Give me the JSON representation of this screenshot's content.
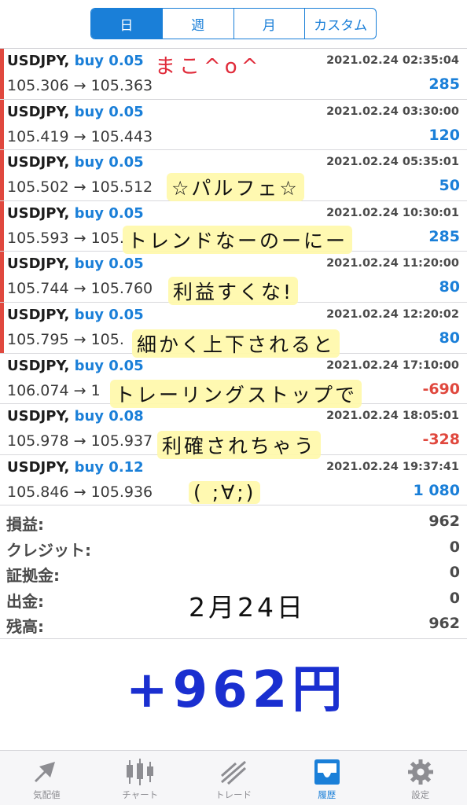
{
  "period_tabs": [
    {
      "label": "日",
      "active": true
    },
    {
      "label": "週",
      "active": false
    },
    {
      "label": "月",
      "active": false
    },
    {
      "label": "カスタム",
      "active": false
    }
  ],
  "deals": [
    {
      "symbol": "USDJPY,",
      "side": "buy 0.05",
      "prices": "105.306 → 105.363",
      "time": "2021.02.24 02:35:04",
      "profit": "285",
      "negative": false
    },
    {
      "symbol": "USDJPY,",
      "side": "buy 0.05",
      "prices": "105.419 → 105.443",
      "time": "2021.02.24 03:30:00",
      "profit": "120",
      "negative": false
    },
    {
      "symbol": "USDJPY,",
      "side": "buy 0.05",
      "prices": "105.502 → 105.512",
      "time": "2021.02.24 05:35:01",
      "profit": "50",
      "negative": false
    },
    {
      "symbol": "USDJPY,",
      "side": "buy 0.05",
      "prices": "105.593 → 105.",
      "time": "2021.02.24 10:30:01",
      "profit": "285",
      "negative": false
    },
    {
      "symbol": "USDJPY,",
      "side": "buy 0.05",
      "prices": "105.744 → 105.760",
      "time": "2021.02.24 11:20:00",
      "profit": "80",
      "negative": false
    },
    {
      "symbol": "USDJPY,",
      "side": "buy 0.05",
      "prices": "105.795 → 105.",
      "time": "2021.02.24 12:20:02",
      "profit": "80",
      "negative": false
    },
    {
      "symbol": "USDJPY,",
      "side": "buy 0.05",
      "prices": "106.074 → 1",
      "time": "2021.02.24 17:10:00",
      "profit": "-690",
      "negative": true
    },
    {
      "symbol": "USDJPY,",
      "side": "buy 0.08",
      "prices": "105.978 → 105.937",
      "time": "2021.02.24 18:05:01",
      "profit": "-328",
      "negative": true
    },
    {
      "symbol": "USDJPY,",
      "side": "buy 0.12",
      "prices": "105.846 → 105.936",
      "time": "2021.02.24 19:37:41",
      "profit": "1 080",
      "negative": false
    }
  ],
  "summary": [
    {
      "label": "損益:",
      "value": "962"
    },
    {
      "label": "クレジット:",
      "value": "0"
    },
    {
      "label": "証拠金:",
      "value": "0"
    },
    {
      "label": "出金:",
      "value": "0"
    },
    {
      "label": "残高:",
      "value": "962"
    }
  ],
  "overlay": {
    "signature": "まこ^o^",
    "line1": "☆パルフェ☆",
    "line2": "トレンドなーのーにー",
    "line3": "利益すくな!",
    "line4": "細かく上下されると",
    "line5": "トレーリングストップで",
    "line6": "利確されちゃう",
    "line7": "( ;∀;)",
    "date": "2月24日",
    "total": "+962円"
  },
  "tabbar": [
    {
      "label": "気配値",
      "icon": "quotes-icon",
      "active": false
    },
    {
      "label": "チャート",
      "icon": "candlestick-icon",
      "active": false
    },
    {
      "label": "トレード",
      "icon": "trade-icon",
      "active": false
    },
    {
      "label": "履歴",
      "icon": "history-inbox-icon",
      "active": true
    },
    {
      "label": "設定",
      "icon": "gear-icon",
      "active": false
    }
  ],
  "colors": {
    "accent": "#1a7fd8",
    "loss": "#e0483e",
    "handwritten_total": "#1a2fd0",
    "signature": "#e02b3a"
  }
}
